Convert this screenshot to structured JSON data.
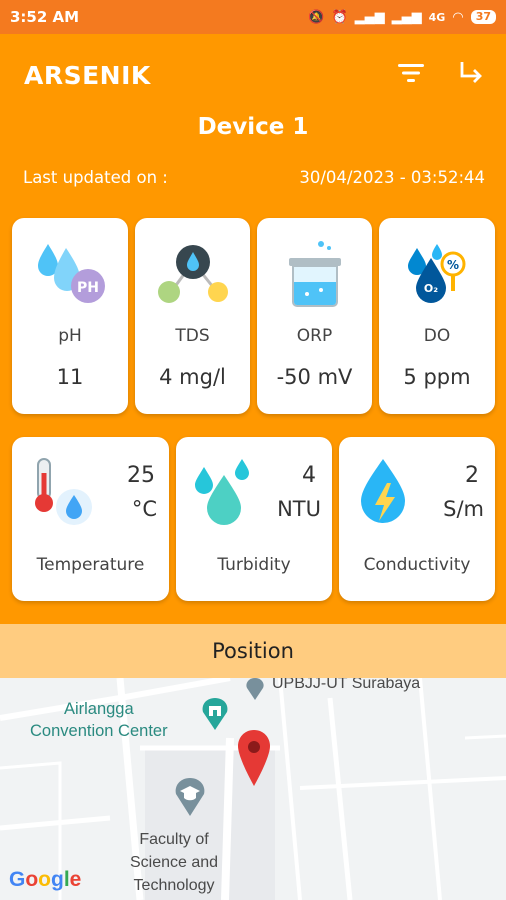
{
  "status": {
    "time": "3:52 AM",
    "battery": "37",
    "network": "4G"
  },
  "app": {
    "name": "ARSENIK",
    "filter_icon": "filter-icon",
    "logout_icon": "logout-arrow-icon"
  },
  "device": {
    "title": "Device 1",
    "updated_label": "Last updated on :",
    "updated_value": "30/04/2023 - 03:52:44"
  },
  "sensors_top": [
    {
      "label": "pH",
      "value": "11",
      "icon": "ph-drops-icon"
    },
    {
      "label": "TDS",
      "value": "4 mg/l",
      "icon": "molecule-icon"
    },
    {
      "label": "ORP",
      "value": "-50 mV",
      "icon": "beaker-icon"
    },
    {
      "label": "DO",
      "value": "5 ppm",
      "icon": "oxygen-drop-icon"
    }
  ],
  "sensors_bottom": [
    {
      "label": "Temperature",
      "value": "25",
      "unit": "°C",
      "icon": "thermometer-icon"
    },
    {
      "label": "Turbidity",
      "value": "4",
      "unit": "NTU",
      "icon": "turbidity-drops-icon"
    },
    {
      "label": "Conductivity",
      "value": "2",
      "unit": "S/m",
      "icon": "conductivity-drop-icon"
    }
  ],
  "position": {
    "title": "Position"
  },
  "map": {
    "labels": {
      "top": "UPBJJ-UT Surabaya",
      "convention": "Airlangga\nConvention Center",
      "faculty": "Faculty of\nScience and\nTechnology"
    },
    "logo": "Google"
  },
  "colors": {
    "primary": "#FF9800",
    "statusbar": "#F47A1F",
    "position_bar": "#FFCC80",
    "marker": "#E53935"
  }
}
